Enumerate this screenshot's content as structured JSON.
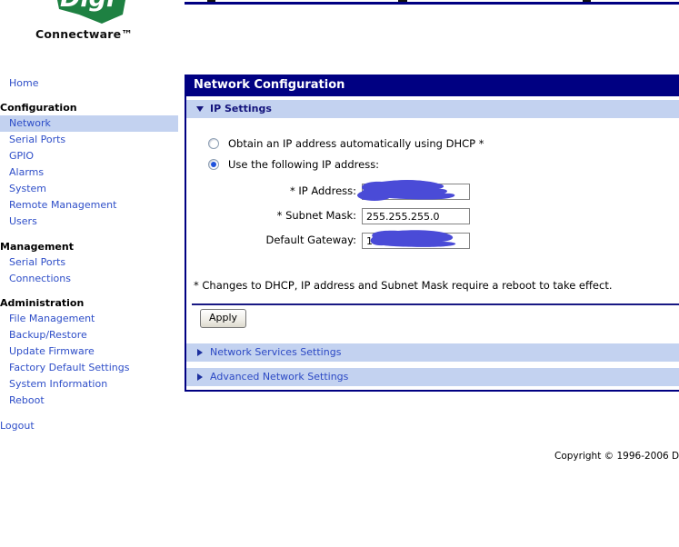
{
  "brand": {
    "logo_text": "Digi",
    "name": "Connectware™"
  },
  "sidebar": {
    "home": "Home",
    "sections": [
      {
        "title": "Configuration",
        "items": [
          "Network",
          "Serial Ports",
          "GPIO",
          "Alarms",
          "System",
          "Remote Management",
          "Users"
        ],
        "active_item": "Network"
      },
      {
        "title": "Management",
        "items": [
          "Serial Ports",
          "Connections"
        ]
      },
      {
        "title": "Administration",
        "items": [
          "File Management",
          "Backup/Restore",
          "Update Firmware",
          "Factory Default Settings",
          "System Information",
          "Reboot"
        ]
      }
    ],
    "logout": "Logout"
  },
  "panel": {
    "title": "Network Configuration",
    "ip_settings": {
      "title": "IP Settings",
      "expanded": true,
      "dhcp_option": "Obtain an IP address automatically using DHCP *",
      "static_option": "Use the following IP address:",
      "selected_option": "static",
      "fields": [
        {
          "label": "* IP Address:",
          "value": "",
          "redacted": true
        },
        {
          "label": "* Subnet Mask:",
          "value": "255.255.255.0",
          "redacted": false
        },
        {
          "label": "Default Gateway:",
          "value": "1",
          "redacted": true
        }
      ],
      "note": "* Changes to DHCP, IP address and Subnet Mask require a reboot to take effect.",
      "apply": "Apply"
    },
    "collapsed_sections": [
      "Network Services Settings",
      "Advanced Network Settings"
    ]
  },
  "footer": {
    "copyright": "Copyright © 1996-2006 D"
  },
  "colors": {
    "navy": "#000082",
    "section_bar_blue": "#c3d2f0",
    "link_blue": "#2e4ec8",
    "logo_green": "#1e8142",
    "redaction_blue": "#4a4bd7"
  },
  "icons": {
    "ip_settings": "triangle-down-icon",
    "collapsed_sections": "triangle-right-icon"
  }
}
